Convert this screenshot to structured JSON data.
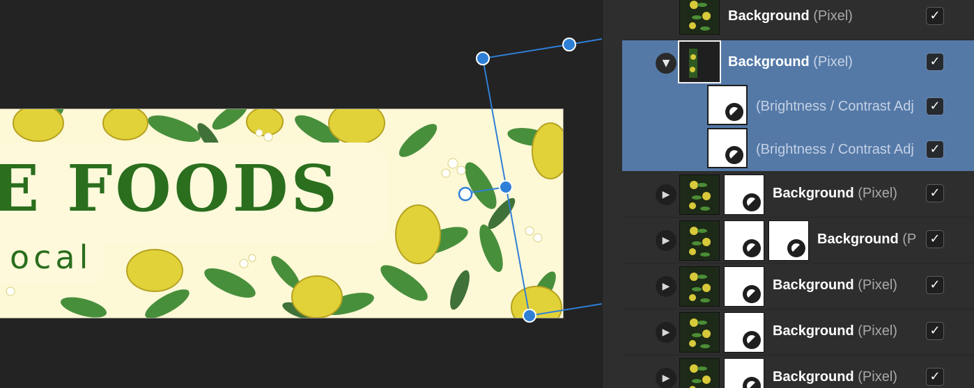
{
  "canvas": {
    "title_text": "E FOODS",
    "subtitle_text": "ocal"
  },
  "layers": {
    "rows": [
      {
        "name": "Background",
        "kind": "(Pixel)",
        "visible": true,
        "visible_mark": "✓"
      },
      {
        "name": "Background",
        "kind": "(Pixel)",
        "visible": true,
        "visible_mark": "✓",
        "selected": true,
        "expanded": true,
        "expander": "▼"
      },
      {
        "name": "(Brightness / Contrast Adjustment)",
        "visible": true,
        "visible_mark": "✓"
      },
      {
        "name": "(Brightness / Contrast Adjustment)",
        "visible": true,
        "visible_mark": "✓"
      },
      {
        "name": "Background",
        "kind": "(Pixel)",
        "visible": true,
        "visible_mark": "✓",
        "expander": "▶"
      },
      {
        "name": "Background",
        "kind": "(Pixel)",
        "visible": true,
        "visible_mark": "✓",
        "expander": "▶"
      },
      {
        "name": "Background",
        "kind": "(Pixel)",
        "visible": true,
        "visible_mark": "✓",
        "expander": "▶"
      },
      {
        "name": "Background",
        "kind": "(Pixel)",
        "visible": true,
        "visible_mark": "✓",
        "expander": "▶"
      },
      {
        "name": "Background",
        "kind": "(Pixel)",
        "visible": true,
        "visible_mark": "✓",
        "expander": "▶"
      }
    ]
  },
  "colors": {
    "selection": "#5479a7",
    "handle": "#2f7fd6",
    "title_green": "#2a6e1e",
    "lemon": "#e2d23a",
    "leaf": "#3f8a34"
  },
  "icons": {
    "adjustment": "brightness-contrast-icon",
    "expand": "disclosure-triangle-icon",
    "visibility": "checkmark-icon"
  }
}
